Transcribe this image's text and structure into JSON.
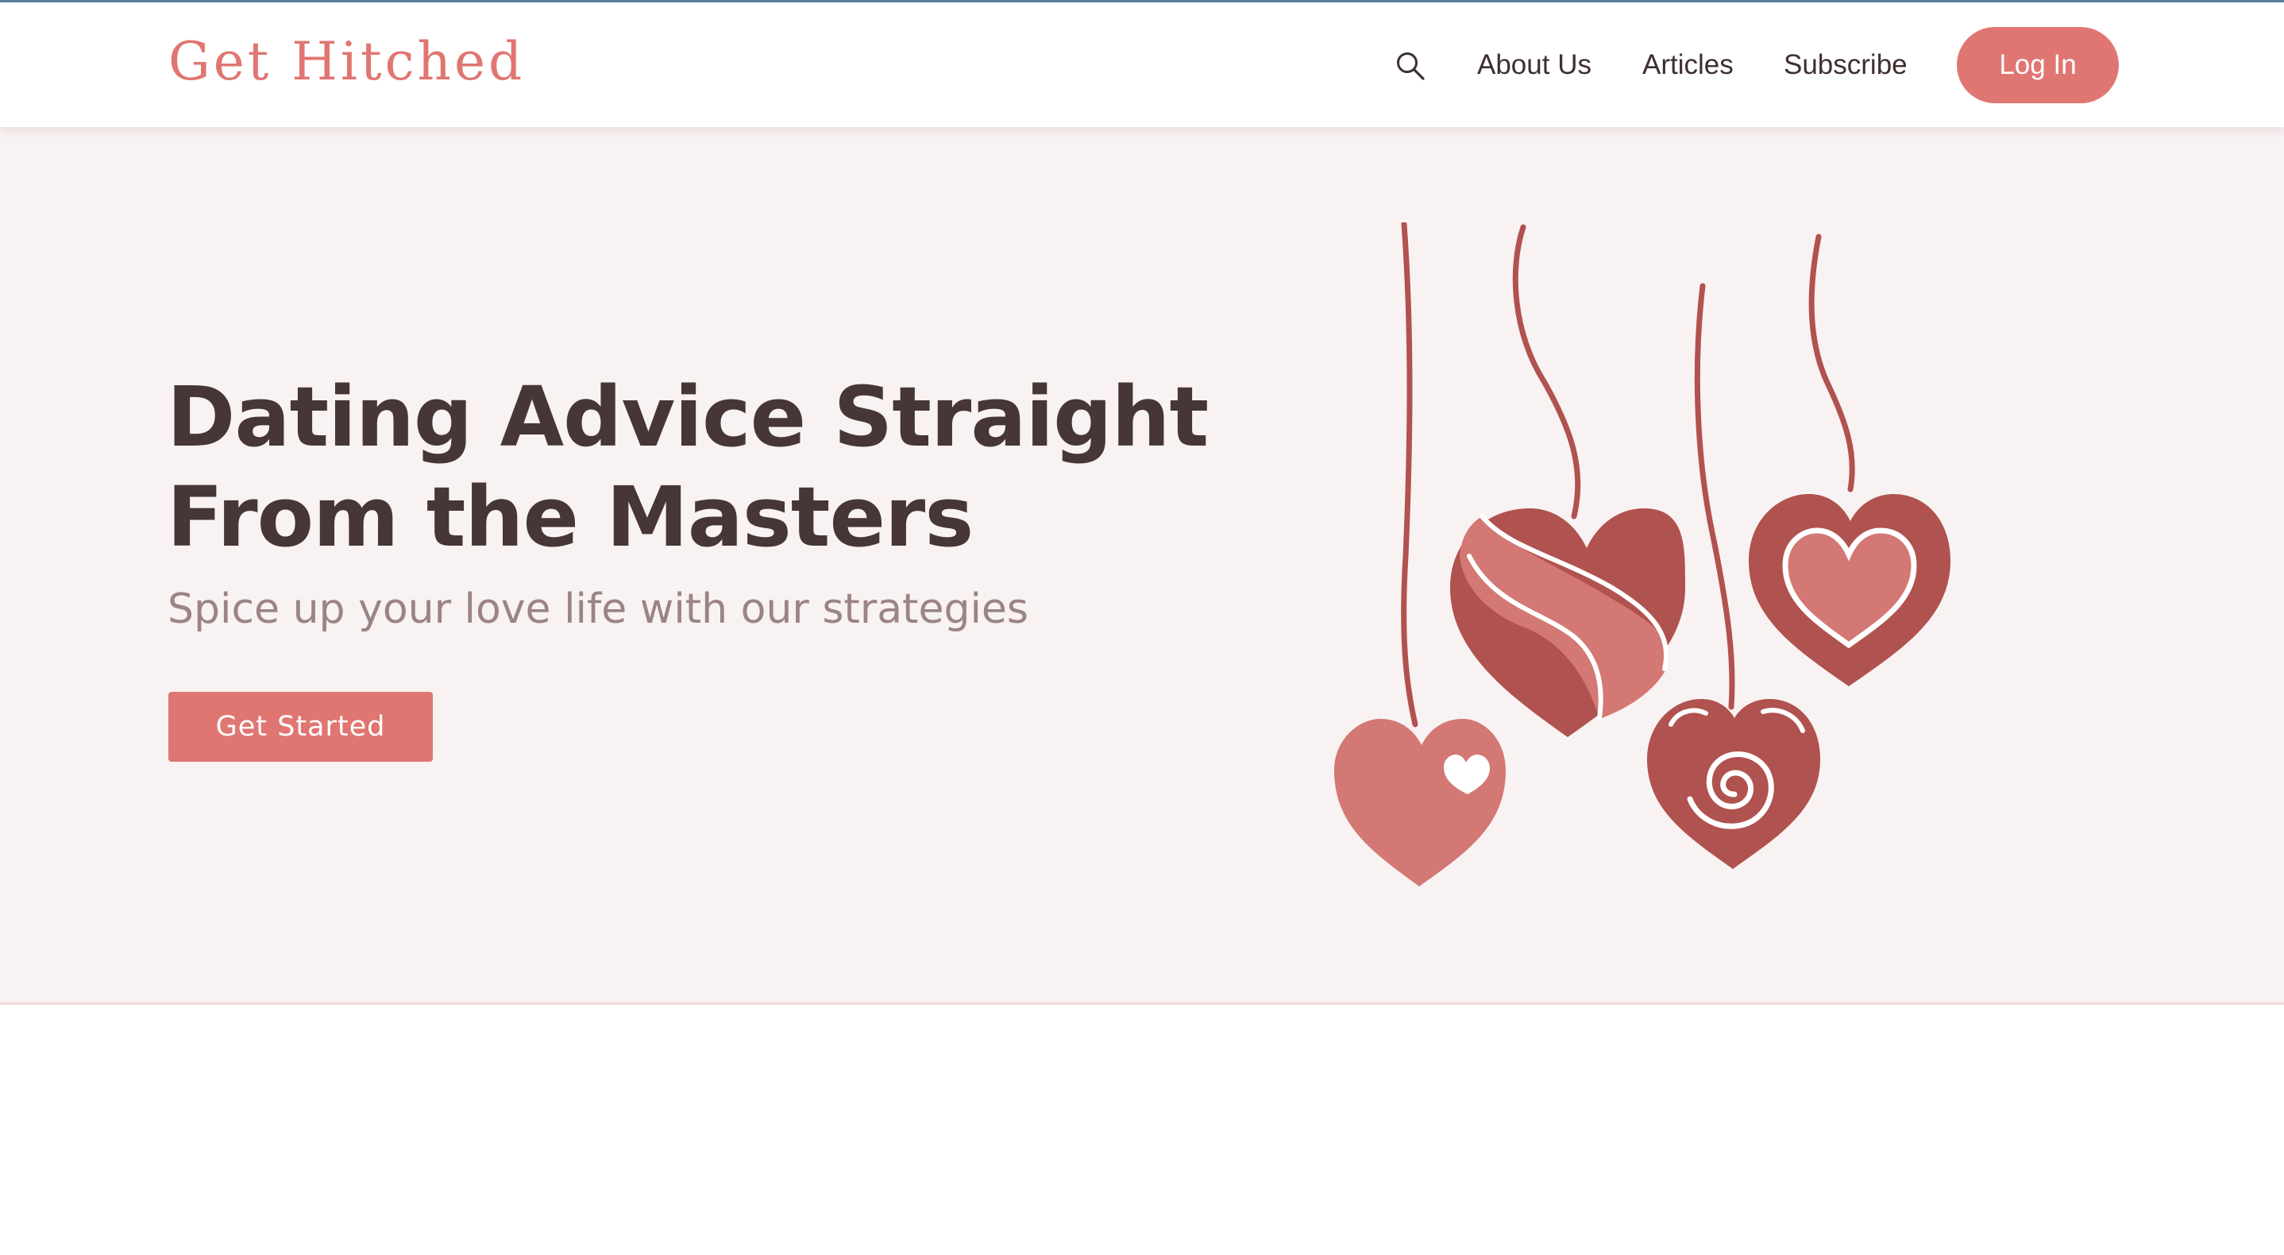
{
  "header": {
    "logo_text": "Get Hitched",
    "search_icon": "search-icon",
    "nav": {
      "about": "About Us",
      "articles": "Articles",
      "subscribe": "Subscribe"
    },
    "login_label": "Log In"
  },
  "hero": {
    "title_line1": "Dating Advice Straight",
    "title_line2": "From the Masters",
    "subtitle": "Spice up your love life with our strategies",
    "cta_label": "Get Started",
    "illustration": "hanging-hearts-illustration"
  },
  "colors": {
    "accent": "#e07672",
    "heading": "#473636",
    "subtitle": "#9b8484",
    "hero_bg": "#f9f2f2",
    "heart_dark": "#b0524f",
    "heart_light": "#d37874"
  }
}
